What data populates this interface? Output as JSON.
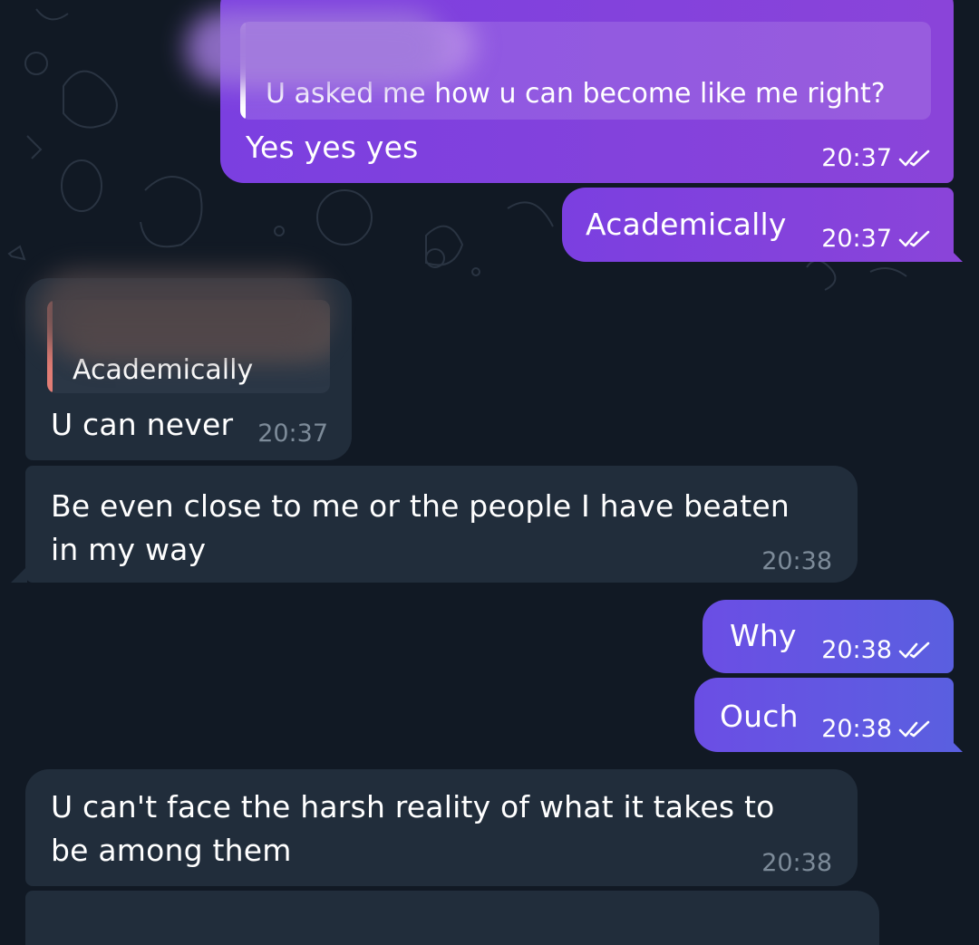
{
  "messages": [
    {
      "id": "m1",
      "direction": "outgoing",
      "reply_to": {
        "sender_redacted": true,
        "text": "U asked me how u can become like me right?"
      },
      "text": "Yes yes yes",
      "time": "20:37",
      "status": "read"
    },
    {
      "id": "m2",
      "direction": "outgoing",
      "text": "Academically",
      "time": "20:37",
      "status": "read"
    },
    {
      "id": "m3",
      "direction": "incoming",
      "reply_to": {
        "sender_redacted": true,
        "text": "Academically"
      },
      "text": "U can never",
      "time": "20:37"
    },
    {
      "id": "m4",
      "direction": "incoming",
      "lines": [
        "Be even close to me or the people I have beaten",
        "in my way"
      ],
      "time": "20:38"
    },
    {
      "id": "m5",
      "direction": "outgoing",
      "text": "Why",
      "time": "20:38",
      "status": "read"
    },
    {
      "id": "m6",
      "direction": "outgoing",
      "text": "Ouch",
      "time": "20:38",
      "status": "read"
    },
    {
      "id": "m7",
      "direction": "incoming",
      "lines": [
        "U can't face the harsh reality of what it takes to",
        "be among them"
      ],
      "time": "20:38"
    }
  ],
  "colors": {
    "background": "#111924",
    "outgoing_purple": "#8a44d9",
    "outgoing_blue": "#5a5fe0",
    "incoming": "#212d3b",
    "incoming_reply_accent": "#e27d75",
    "timestamp_incoming": "#7d8b99"
  },
  "icons": {
    "read_status": "double-check-icon"
  }
}
